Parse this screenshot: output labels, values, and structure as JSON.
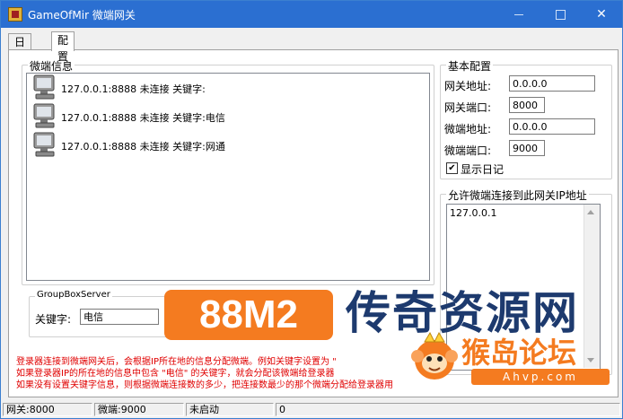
{
  "window": {
    "title": "GameOfMir 微端网关",
    "minimize_icon": "minimize-icon",
    "maximize_icon": "maximize-icon",
    "close_glyph": "✕"
  },
  "tabs": [
    {
      "label": "日记",
      "active": false
    },
    {
      "label": "配置",
      "active": true
    }
  ],
  "microclient_info": {
    "title": "微端信息",
    "items": [
      {
        "icon": "computer-icon",
        "text": "127.0.0.1:8888 未连接 关键字:"
      },
      {
        "icon": "computer-icon",
        "text": "127.0.0.1:8888 未连接 关键字:电信"
      },
      {
        "icon": "computer-icon",
        "text": "127.0.0.1:8888 未连接 关键字:网通"
      }
    ]
  },
  "groupbox_server": {
    "title": "GroupBoxServer",
    "keyword_label": "关键字:",
    "keyword_value": "电信"
  },
  "basic_config": {
    "title": "基本配置",
    "gateway_address_label": "网关地址:",
    "gateway_address_value": "0.0.0.0",
    "gateway_port_label": "网关端口:",
    "gateway_port_value": "8000",
    "microclient_address_label": "微端地址:",
    "microclient_address_value": "0.0.0.0",
    "microclient_port_label": "微端端口:",
    "microclient_port_value": "9000",
    "show_log_label": "显示日记",
    "show_log_checked": true,
    "check_glyph": "✔"
  },
  "allowed_ips": {
    "title": "允许微端连接到此网关IP地址",
    "items": [
      "127.0.0.1"
    ]
  },
  "info_lines": [
    "登录器连接到微端网关后，会根据IP所在地的信息分配微端。例如关键字设置为 \"",
    "如果登录器IP的所在地的信息中包含 \"电信\" 的关键字，就会分配该微端给登录器",
    "如果没有设置关键字信息，则根据微端连接数的多少，把连接数最少的那个微端分配给登录器用"
  ],
  "status_bar": [
    "网关:8000",
    "微端:9000",
    "未启动",
    "0"
  ],
  "watermark": {
    "badge": "88M2",
    "text": "传奇资源网",
    "sub": "猴岛论坛",
    "url": "Ahvp.com",
    "logo_icon": "monkey-logo-icon"
  },
  "colors": {
    "titlebar": "#2b6fd1",
    "info_text": "#e00000",
    "watermark_orange": "#f47b20",
    "watermark_blue": "#1d3a6e"
  }
}
